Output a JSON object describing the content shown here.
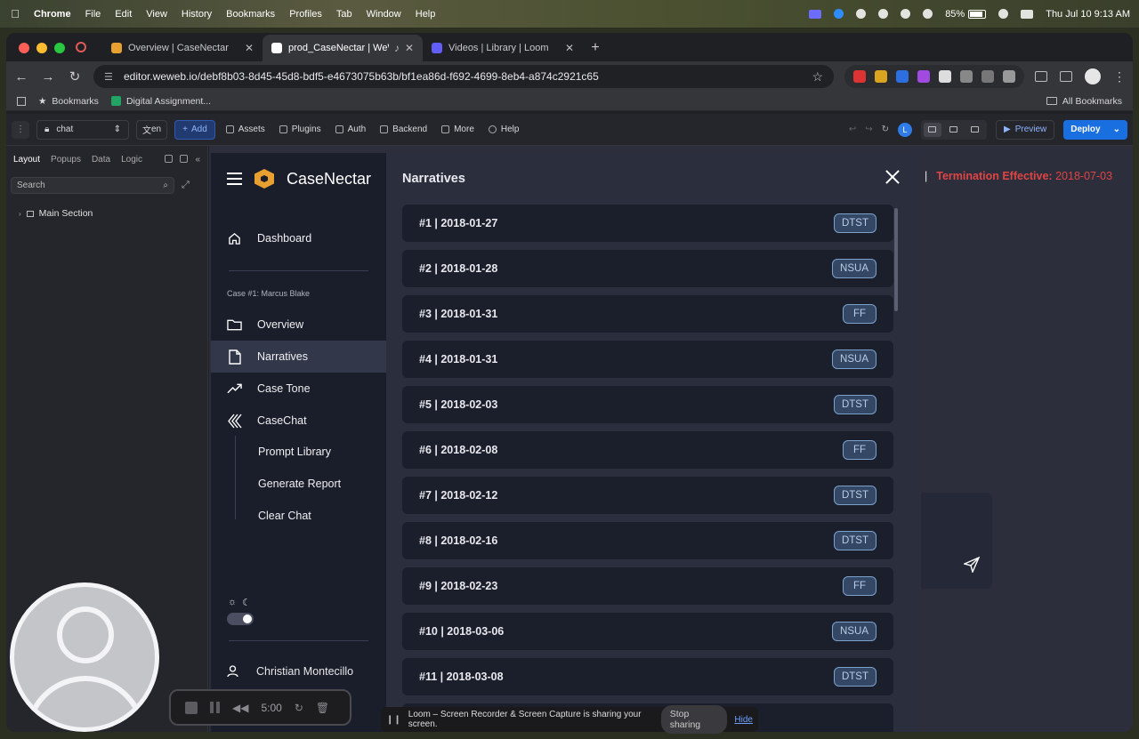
{
  "menubar": {
    "app": "Chrome",
    "items": [
      "File",
      "Edit",
      "View",
      "History",
      "Bookmarks",
      "Profiles",
      "Tab",
      "Window",
      "Help"
    ],
    "battery": "85%",
    "datetime": "Thu Jul 10  9:13 AM"
  },
  "browser": {
    "tabs": [
      {
        "title": "Overview | CaseNectar",
        "color": "#e8a030"
      },
      {
        "title": "prod_CaseNectar | WeWe",
        "color": "#ffffff"
      },
      {
        "title": "Videos | Library | Loom",
        "color": "#625df5"
      }
    ],
    "url": "editor.weweb.io/debf8b03-8d45-45d8-bdf5-e4673075b63b/bf1ea86d-f692-4699-8eb4-a874c2921c65",
    "bookmarks": [
      "Bookmarks",
      "Digital Assignment..."
    ],
    "all_bookmarks": "All Bookmarks"
  },
  "editor_toolbar": {
    "page_select": "chat",
    "lang": "en",
    "add": "Add",
    "items": [
      "Assets",
      "Plugins",
      "Auth",
      "Backend",
      "More",
      "Help"
    ],
    "user_initial": "L",
    "preview": "Preview",
    "deploy": "Deploy"
  },
  "left_panel": {
    "tabs": [
      "Layout",
      "Popups",
      "Data",
      "Logic"
    ],
    "search_placeholder": "Search",
    "tree_item": "Main Section"
  },
  "app": {
    "brand": "CaseNectar",
    "nav": {
      "dashboard": "Dashboard",
      "case_label": "Case #1: Marcus Blake",
      "overview": "Overview",
      "narratives": "Narratives",
      "case_tone": "Case Tone",
      "casechat": "CaseChat",
      "prompt_library": "Prompt Library",
      "generate_report": "Generate Report",
      "clear_chat": "Clear Chat",
      "user": "Christian Montecillo"
    },
    "header": {
      "separator": "|",
      "termination_label": "Termination Effective:",
      "termination_date": "2018-07-03"
    }
  },
  "narratives": {
    "title": "Narratives",
    "items": [
      {
        "label": "#1 | 2018-01-27",
        "badge": "DTST"
      },
      {
        "label": "#2 | 2018-01-28",
        "badge": "NSUA"
      },
      {
        "label": "#3 | 2018-01-31",
        "badge": "FF"
      },
      {
        "label": "#4 | 2018-01-31",
        "badge": "NSUA"
      },
      {
        "label": "#5 | 2018-02-03",
        "badge": "DTST"
      },
      {
        "label": "#6 | 2018-02-08",
        "badge": "FF"
      },
      {
        "label": "#7 | 2018-02-12",
        "badge": "DTST"
      },
      {
        "label": "#8 | 2018-02-16",
        "badge": "DTST"
      },
      {
        "label": "#9 | 2018-02-23",
        "badge": "FF"
      },
      {
        "label": "#10 | 2018-03-06",
        "badge": "NSUA"
      },
      {
        "label": "#11 | 2018-03-08",
        "badge": "DTST"
      }
    ]
  },
  "loom": {
    "timer": "5:00",
    "share_text": "Loom – Screen Recorder & Screen Capture is sharing your screen.",
    "stop_sharing": "Stop sharing",
    "hide": "Hide"
  }
}
